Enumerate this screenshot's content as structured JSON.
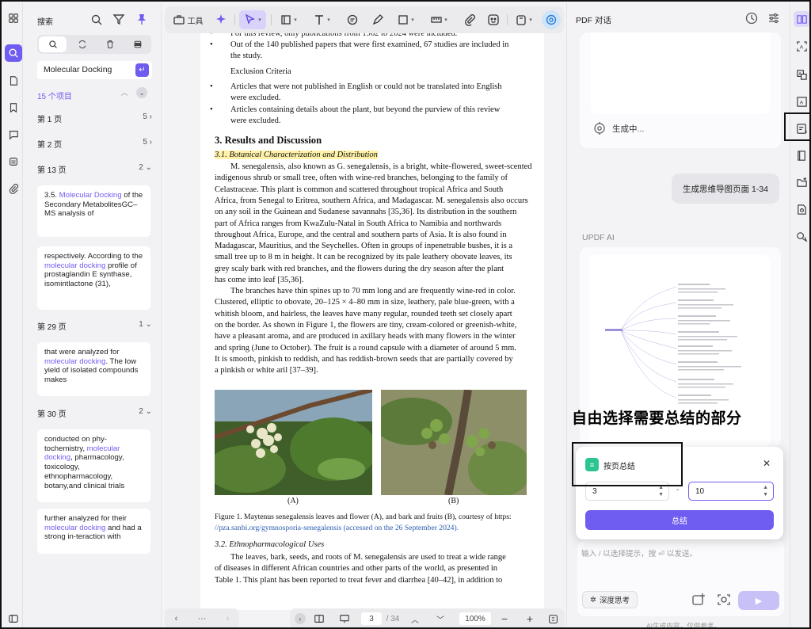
{
  "search_panel": {
    "title": "搜索",
    "query": "Molecular Docking",
    "result_count": "15 个项目",
    "pages": [
      {
        "label": "第 1 页",
        "count": "5",
        "chev": "›"
      },
      {
        "label": "第 2 页",
        "count": "5",
        "chev": "›"
      },
      {
        "label": "第 13 页",
        "count": "2",
        "chev": "⌄"
      },
      {
        "label": "第 29 页",
        "count": "1",
        "chev": "⌄"
      },
      {
        "label": "第 30 页",
        "count": "2",
        "chev": "⌄"
      }
    ],
    "results": [
      {
        "before": "3.5. ",
        "match": "Molecular Docking",
        "after": " of the Secondary MetabolitesGC–MS analysis of"
      },
      {
        "before": "respectively. According to the ",
        "match": "molecular docking",
        "after": " profile of prostaglandin E synthase, isomintlactone (31),"
      },
      {
        "before": "that were analyzed for ",
        "match": "molecular docking",
        "after": ". The low yield of isolated compounds makes"
      },
      {
        "before": "conducted on phy-tochemistry, ",
        "match": "molecular docking",
        "after": ", pharmacology, toxicology, ethnopharmacology, botany,and clinical trials"
      },
      {
        "before": "further analyzed for their ",
        "match": "molecular docking",
        "after": " and had a strong in-teraction with"
      }
    ]
  },
  "toolbar": {
    "tools_label": "工具"
  },
  "document": {
    "bullets_top": [
      "For this review, only publications from 1962 to 2024 were included.",
      "Out of the 140 published papers that were first examined, 67 studies are included in",
      "the study."
    ],
    "exclusion_heading": "Exclusion Criteria",
    "exclusion_bullets": [
      "Articles that were not published in English or could not be translated into English",
      "were excluded.",
      "Articles containing details about the plant, but beyond the purview of this review",
      "were excluded."
    ],
    "section_title": "3. Results and Discussion",
    "subsection_1": "3.1. Botanical Characterization and Distribution",
    "para1": [
      "M. senegalensis, also known as G. senegalensis, is a bright, white-flowered, sweet-scented",
      "indigenous shrub or small tree, often with wine-red branches, belonging to the family of",
      "Celastraceae. This plant is common and scattered throughout tropical Africa and South",
      "Africa, from Senegal to Eritrea, southern Africa, and Madagascar. M. senegalensis also occurs",
      "on any soil in the Guinean and Sudanese savannahs [35,36]. Its distribution in the southern",
      "part of Africa ranges from KwaZulu-Natal in South Africa to Namibia and northwards",
      "throughout Africa, Europe, and the central and southern parts of Asia. It is also found in",
      "Madagascar, Mauritius, and the Seychelles. Often in groups of inpenetrable bushes, it is a",
      "small tree up to 8 m in height. It can be recognized by its pale leathery obovate leaves, its",
      "grey scaly bark with red branches, and the flowers during the dry season after the plant",
      "has come into leaf [35,36]."
    ],
    "para2": [
      "The branches have thin spines up to 70 mm long and are frequently wine-red in color.",
      "Clustered, elliptic to obovate, 20–125 × 4–80 mm in size, leathery, pale blue-green, with a",
      "whitish bloom, and hairless, the leaves have many regular, rounded teeth set closely apart",
      "on the border. As shown in Figure 1, the flowers are tiny, cream-colored or greenish-white,",
      "have a pleasant aroma, and are produced in axillary heads with many flowers in the winter",
      "and spring (June to October). The fruit is a round capsule with a diameter of around 5 mm.",
      "It is smooth, pinkish to reddish, and has reddish-brown seeds that are partially covered by",
      "a pinkish or white aril [37–39]."
    ],
    "fig_label_a": "(A)",
    "fig_label_b": "(B)",
    "figure_caption_1": "Figure 1. Maytenus senegalensis leaves and flower (A), and bark and fruits (B), courtesy of https:",
    "figure_caption_2": "//pza.sanbi.org/gymnosporia-senegalensis (accessed on the 26 September 2024).",
    "subsection_2": "3.2. Ethnopharmacological Uses",
    "para3": [
      "The leaves, bark, seeds, and roots of M. senegalensis are used to treat a wide range",
      "of diseases in different African countries and other parts of the world, as presented in",
      "Table 1. This plant has been reported to treat fever and diarrhea [40–42], in addition to"
    ]
  },
  "page_nav": {
    "current_page": "3",
    "total_pages": "/ 34",
    "zoom": "100%",
    "more": "···"
  },
  "ai_panel": {
    "title": "PDF 对话",
    "generating": "生成中...",
    "user_message": "生成思维导图页面 1-34",
    "sender_label": "UPDF AI",
    "annotation": "自由选择需要总结的部分",
    "popup": {
      "title": "按页总结",
      "from_page": "3",
      "to_page": "10",
      "dash": "-",
      "button": "总结"
    },
    "composer": {
      "placeholder": "输入 / 以选择提示，按 ⏎ 以发送。",
      "deep_think": "深度思考"
    },
    "footer": "AI生成内容，仅供参考。"
  },
  "colors": {
    "accent": "#6f5cf0",
    "highlight": "#fff2a8",
    "link": "#2a5db0",
    "summary_icon": "#2cc493"
  }
}
